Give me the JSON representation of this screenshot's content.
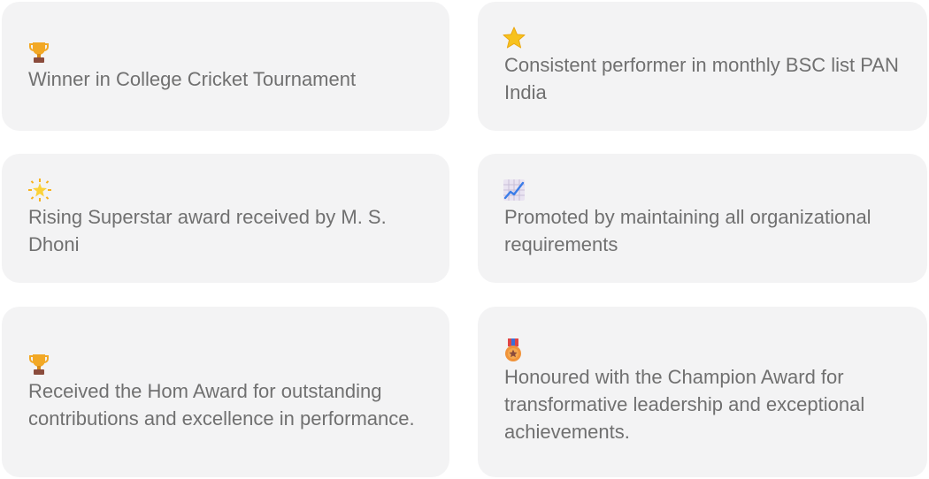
{
  "achievements": [
    {
      "icon": "trophy-icon",
      "text": "Winner in College Cricket Tournament"
    },
    {
      "icon": "star-icon",
      "text": "Consistent performer in monthly BSC list PAN India"
    },
    {
      "icon": "glowing-star-icon",
      "text": "Rising Superstar award received by M. S. Dhoni"
    },
    {
      "icon": "chart-increasing-icon",
      "text": "Promoted by maintaining all organizational requirements"
    },
    {
      "icon": "trophy-icon",
      "text": "Received the Hom Award for outstanding contributions and excellence in performance."
    },
    {
      "icon": "medal-icon",
      "text": "Honoured with the Champion Award for transformative leadership and exceptional achievements."
    }
  ],
  "colors": {
    "card_background": "#f3f3f4",
    "text": "#707070",
    "trophy_gold": "#f2a825",
    "trophy_base": "#8a4b3c",
    "star_yellow": "#f7c21e",
    "chart_line": "#3b7de8",
    "medal_orange": "#f0933a",
    "ribbon_blue": "#3d6fd8",
    "ribbon_red": "#e04545"
  }
}
